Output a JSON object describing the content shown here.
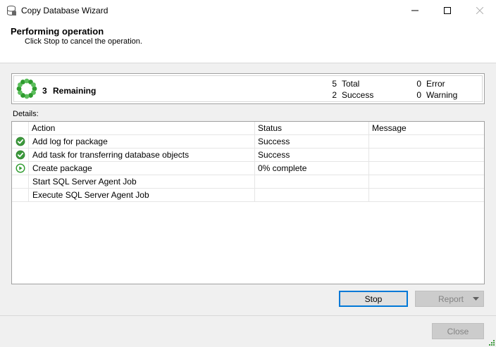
{
  "window": {
    "title": "Copy Database Wizard"
  },
  "header": {
    "title": "Performing operation",
    "subtitle": "Click Stop to cancel the operation."
  },
  "summary": {
    "remaining_count": "3",
    "remaining_label": "Remaining",
    "total_count": "5",
    "total_label": "Total",
    "success_count": "2",
    "success_label": "Success",
    "error_count": "0",
    "error_label": "Error",
    "warning_count": "0",
    "warning_label": "Warning"
  },
  "details": {
    "label": "Details:",
    "columns": [
      "Action",
      "Status",
      "Message"
    ],
    "rows": [
      {
        "icon": "success-icon",
        "action": "Add log for package",
        "status": "Success",
        "message": ""
      },
      {
        "icon": "success-icon",
        "action": "Add task for transferring database objects",
        "status": "Success",
        "message": ""
      },
      {
        "icon": "in-progress-icon",
        "action": "Create package",
        "status": "0% complete",
        "message": ""
      },
      {
        "icon": "",
        "action": "Start SQL Server Agent Job",
        "status": "",
        "message": ""
      },
      {
        "icon": "",
        "action": "Execute SQL Server Agent Job",
        "status": "",
        "message": ""
      }
    ]
  },
  "buttons": {
    "stop": "Stop",
    "report": "Report",
    "close": "Close"
  },
  "colors": {
    "success_green": "#3c9a3c",
    "progress_green": "#2e9b2e",
    "focus_blue": "#0078d7"
  }
}
